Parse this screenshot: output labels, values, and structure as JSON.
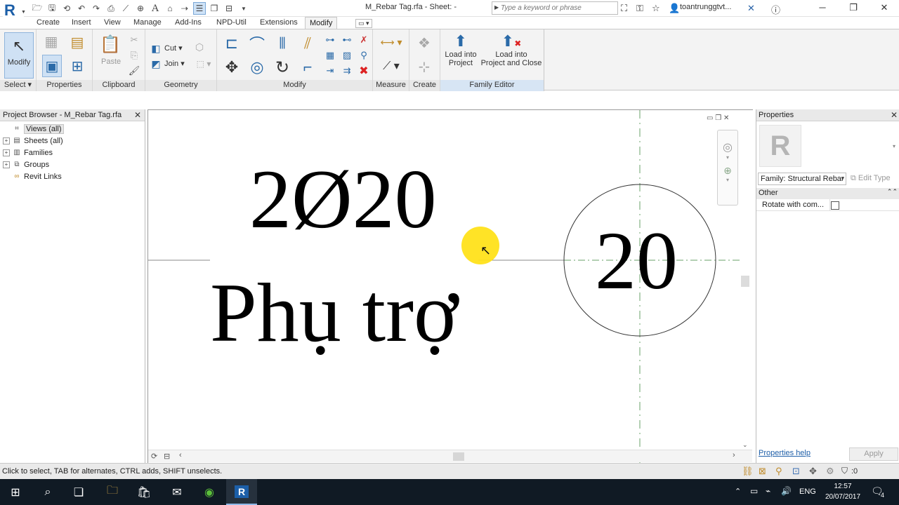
{
  "title_bar": {
    "document_title": "M_Rebar Tag.rfa - Sheet: -",
    "search_placeholder": "Type a keyword or phrase",
    "user_name": "toantrunggtvt..."
  },
  "tabs": [
    "Create",
    "Insert",
    "View",
    "Manage",
    "Add-Ins",
    "NPD-Util",
    "Extensions",
    "Modify"
  ],
  "active_tab": "Modify",
  "ribbon": {
    "select": {
      "modify_label": "Modify",
      "panel_label": "Select"
    },
    "properties": {
      "panel_label": "Properties"
    },
    "clipboard": {
      "paste_label": "Paste",
      "panel_label": "Clipboard"
    },
    "geometry": {
      "cut_label": "Cut",
      "join_label": "Join",
      "panel_label": "Geometry"
    },
    "modify": {
      "panel_label": "Modify"
    },
    "measure": {
      "panel_label": "Measure"
    },
    "create": {
      "panel_label": "Create"
    },
    "family_editor": {
      "load_project_line1": "Load into",
      "load_project_line2": "Project",
      "load_close_line1": "Load into",
      "load_close_line2": "Project and Close",
      "panel_label": "Family Editor"
    }
  },
  "project_browser": {
    "title": "Project Browser - M_Rebar Tag.rfa",
    "items": [
      {
        "label": "Views (all)",
        "expander": "",
        "icon": "views-icon"
      },
      {
        "label": "Sheets (all)",
        "expander": "+",
        "icon": "sheets-icon"
      },
      {
        "label": "Families",
        "expander": "+",
        "icon": "families-icon"
      },
      {
        "label": "Groups",
        "expander": "+",
        "icon": "groups-icon"
      },
      {
        "label": "Revit Links",
        "expander": "",
        "icon": "links-icon"
      }
    ]
  },
  "canvas": {
    "tag_text_line1": "2Ø20",
    "tag_text_line2": "Phụ trợ",
    "circle_label": "20"
  },
  "properties": {
    "title": "Properties",
    "family_select": "Family: Structural Rebar Tags",
    "edit_type_label": "Edit Type",
    "group_other": "Other",
    "rotate_label": "Rotate with com...",
    "rotate_checked": false,
    "help_link": "Properties help",
    "apply_label": "Apply"
  },
  "status_bar": {
    "message": "Click to select, TAB for alternates, CTRL adds, SHIFT unselects.",
    "filter_count": ":0"
  },
  "taskbar": {
    "language": "ENG",
    "time": "12:57",
    "date": "20/07/2017",
    "notification_count": "4"
  }
}
